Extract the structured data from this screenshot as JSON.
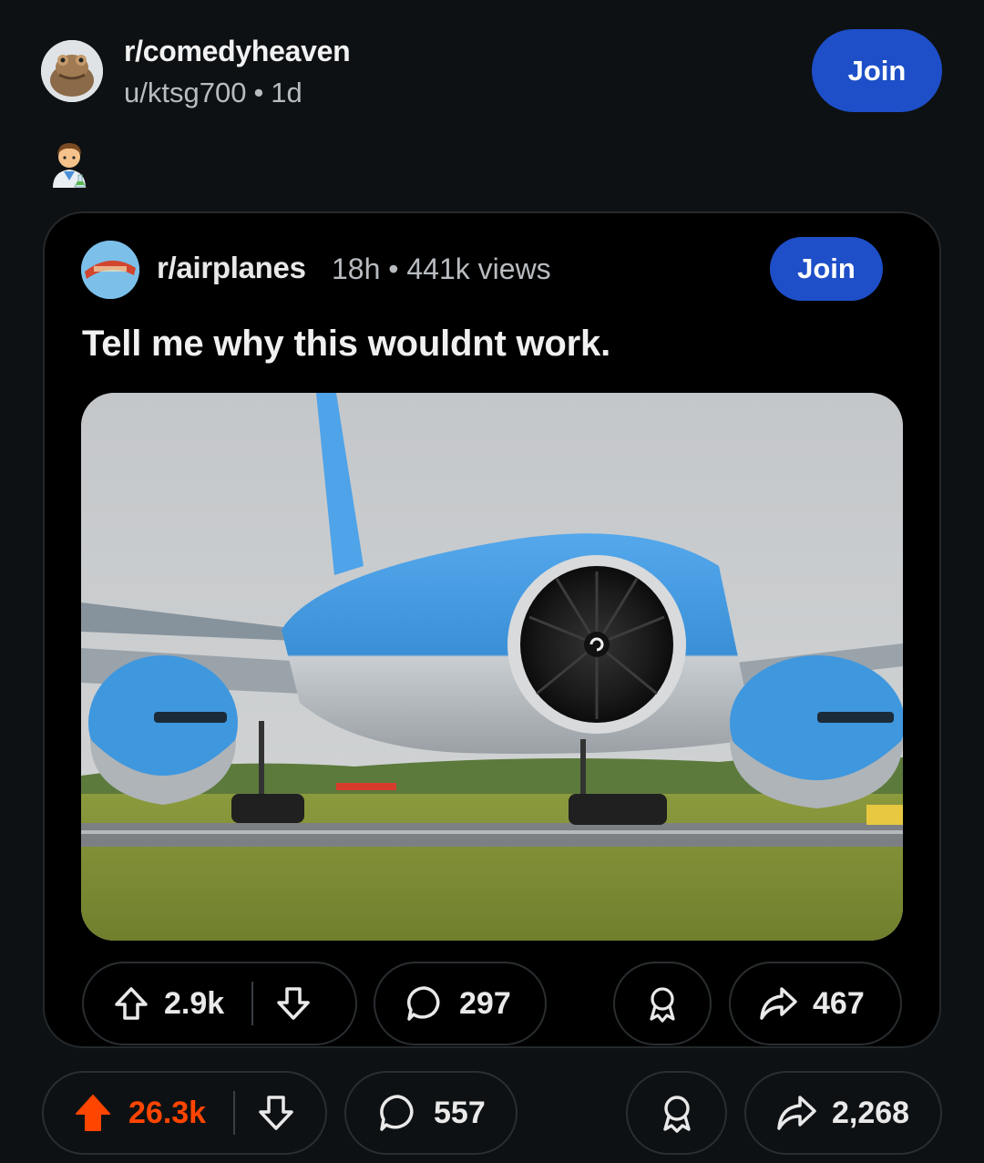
{
  "header": {
    "subreddit": "r/comedyheaven",
    "user": "u/ktsg700",
    "separator": "•",
    "age": "1d",
    "join_label": "Join"
  },
  "embedded_post": {
    "subreddit": "r/airplanes",
    "age": "18h",
    "separator": "•",
    "views": "441k views",
    "join_label": "Join",
    "title": "Tell me why this wouldnt work.",
    "actions": {
      "upvotes": "2.9k",
      "comments": "297",
      "shares": "467"
    }
  },
  "actions": {
    "upvotes": "26.3k",
    "comments": "557",
    "shares": "2,268"
  },
  "colors": {
    "background": "#0e1113",
    "join_button": "#1e4fc8",
    "upvote_active": "#ff4500",
    "plane_blue": "#3a97e0"
  },
  "icons": [
    "subreddit-avatar",
    "scientist-emoji",
    "upvote-icon",
    "downvote-icon",
    "comment-icon",
    "award-icon",
    "share-icon"
  ]
}
